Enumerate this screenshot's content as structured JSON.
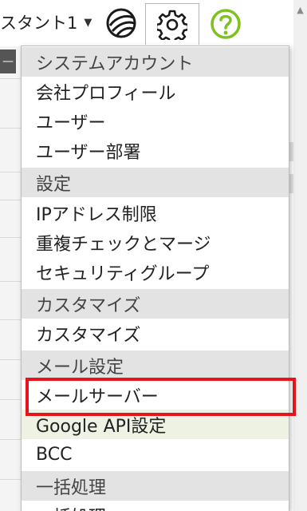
{
  "topbar": {
    "assistant_label": "スタント1",
    "caret": "▼",
    "globe_icon": "globe-icon",
    "gear_icon": "gear-icon",
    "help_icon": "help-icon",
    "help_color": "#7dc21e"
  },
  "background": {
    "dark_tab_label": "—"
  },
  "menu": {
    "sections": [
      {
        "header": "システムアカウント",
        "items": [
          "会社プロフィール",
          "ユーザー",
          "ユーザー部署"
        ]
      },
      {
        "header": "設定",
        "items": [
          "IPアドレス制限",
          "重複チェックとマージ",
          "セキュリティグループ"
        ]
      },
      {
        "header": "カスタマイズ",
        "items": [
          "カスタマイズ"
        ]
      },
      {
        "header": "メール設定",
        "items": [
          "メールサーバー",
          "Google API設定",
          "BCC"
        ]
      },
      {
        "header": "一括処理",
        "items": [
          "一括処理"
        ]
      }
    ],
    "selected_item": "メールサーバー",
    "hovered_item": "Google API設定",
    "highlight_color": "#e8141b"
  }
}
